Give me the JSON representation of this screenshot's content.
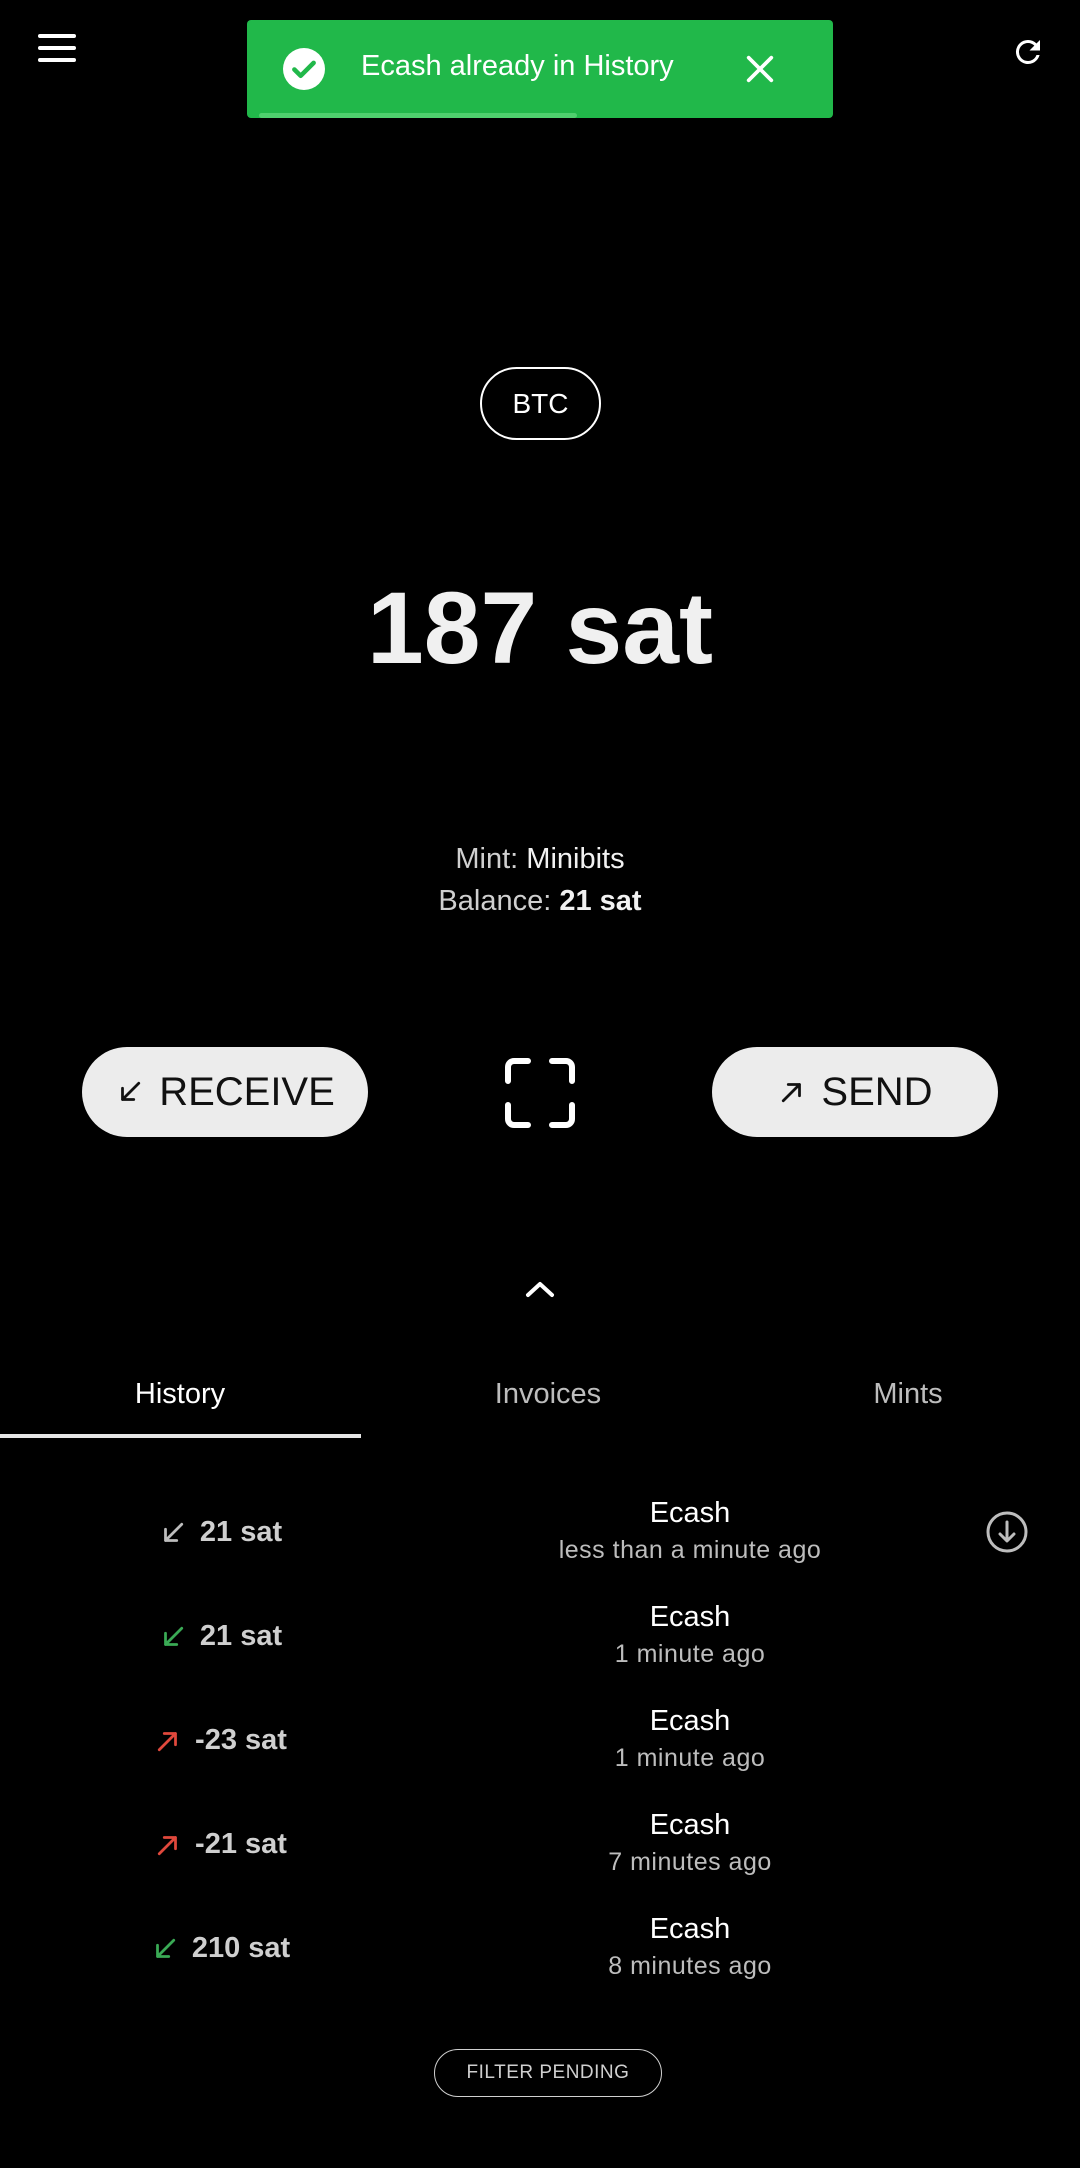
{
  "toast": {
    "message": "Ecash already in History",
    "color": "#21b84a"
  },
  "currency": {
    "label": "BTC"
  },
  "balance": {
    "total": "187 sat",
    "mint_label": "Mint:",
    "mint_name": "Minibits",
    "balance_label": "Balance:",
    "balance_value": "21 sat"
  },
  "actions": {
    "receive_label": "RECEIVE",
    "send_label": "SEND"
  },
  "tabs": [
    {
      "label": "History",
      "active": true
    },
    {
      "label": "Invoices",
      "active": false
    },
    {
      "label": "Mints",
      "active": false
    }
  ],
  "history": [
    {
      "amount": "21 sat",
      "direction": "in",
      "arrow_color": "#bdbdbd",
      "title": "Ecash",
      "time": "less than a minute ago",
      "pending": true
    },
    {
      "amount": "21 sat",
      "direction": "in",
      "arrow_color": "#3aaa55",
      "title": "Ecash",
      "time": "1 minute ago",
      "pending": false
    },
    {
      "amount": "-23 sat",
      "direction": "out",
      "arrow_color": "#e0483c",
      "title": "Ecash",
      "time": "1 minute ago",
      "pending": false
    },
    {
      "amount": "-21 sat",
      "direction": "out",
      "arrow_color": "#e0483c",
      "title": "Ecash",
      "time": "7 minutes ago",
      "pending": false
    },
    {
      "amount": "210 sat",
      "direction": "in",
      "arrow_color": "#3aaa55",
      "title": "Ecash",
      "time": "8 minutes ago",
      "pending": false
    }
  ],
  "filter": {
    "label": "FILTER PENDING"
  }
}
